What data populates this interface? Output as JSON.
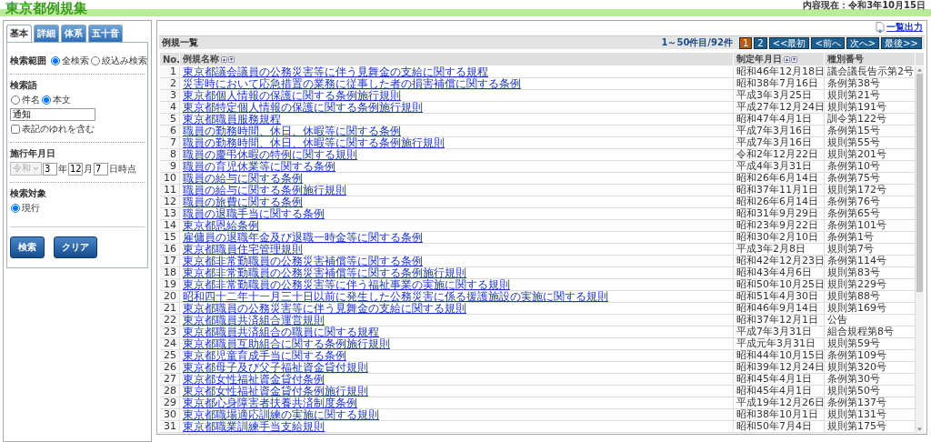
{
  "header": {
    "title": "東京都例規集",
    "as_of": "内容現在：令和3年10月15日"
  },
  "search_panel": {
    "tabs": [
      {
        "label": "基本",
        "selected": true
      },
      {
        "label": "詳細",
        "selected": false
      },
      {
        "label": "体系",
        "selected": false
      },
      {
        "label": "五十音",
        "selected": false
      }
    ],
    "scope": {
      "label": "検索範囲",
      "options": [
        {
          "label": "全検索",
          "selected": true
        },
        {
          "label": "絞込み検索",
          "selected": false
        }
      ]
    },
    "keyword": {
      "label": "検索語",
      "options": [
        {
          "label": "件名",
          "selected": false
        },
        {
          "label": "本文",
          "selected": true
        }
      ],
      "value": "通知",
      "variant_checkbox": {
        "label": "表記のゆれを含む",
        "checked": false
      }
    },
    "effective_date": {
      "label": "施行年月日",
      "era": "令和",
      "era_disabled": true,
      "year": "3",
      "year_unit": "年",
      "month": "12",
      "month_unit": "月",
      "day": "7",
      "day_unit": "日時点"
    },
    "target": {
      "label": "検索対象",
      "options": [
        {
          "label": "現行",
          "selected": true
        }
      ]
    },
    "buttons": [
      "検索",
      "クリア"
    ]
  },
  "results": {
    "export_link": "一覧出力",
    "title": "例規一覧",
    "range": "1～50件目/92件",
    "pages": [
      {
        "label": "1",
        "selected": true
      },
      {
        "label": "2",
        "selected": false
      }
    ],
    "nav": [
      "<<最初",
      "<前へ",
      "次へ>",
      "最後>>"
    ],
    "columns": [
      {
        "label": "No.",
        "sortable": false
      },
      {
        "label": "例規名称",
        "sortable": true
      },
      {
        "label": "制定年月日",
        "sortable": true
      },
      {
        "label": "種別番号",
        "sortable": false
      }
    ],
    "rows": [
      [
        "1",
        "東京都議会議員の公務災害等に伴う見舞金の支給に関する規程",
        "昭和46年12月18日",
        "議会議長告示第2号"
      ],
      [
        "2",
        "災害時において応急措置の業務に従事した者の損害補償に関する条例",
        "昭和38年7月16日",
        "条例第38号"
      ],
      [
        "3",
        "東京都個人情報の保護に関する条例施行規則",
        "平成3年3月25日",
        "規則第21号"
      ],
      [
        "4",
        "東京都特定個人情報の保護に関する条例施行規則",
        "平成27年12月24日",
        "規則第191号"
      ],
      [
        "5",
        "東京都職員服務規程",
        "昭和47年4月1日",
        "訓令第122号"
      ],
      [
        "6",
        "職員の勤務時間、休日、休暇等に関する条例",
        "平成7年3月16日",
        "条例第15号"
      ],
      [
        "7",
        "職員の勤務時間、休日、休暇等に関する条例施行規則",
        "平成7年3月16日",
        "規則第55号"
      ],
      [
        "8",
        "職員の慶弔休暇の特例に関する規則",
        "令和2年12月22日",
        "規則第201号"
      ],
      [
        "9",
        "職員の育児休業等に関する条例",
        "平成4年3月31日",
        "条例第10号"
      ],
      [
        "10",
        "職員の給与に関する条例",
        "昭和26年6月14日",
        "条例第75号"
      ],
      [
        "11",
        "職員の給与に関する条例施行規則",
        "昭和37年11月1日",
        "規則第172号"
      ],
      [
        "12",
        "職員の旅費に関する条例",
        "昭和26年6月14日",
        "条例第76号"
      ],
      [
        "13",
        "職員の退職手当に関する条例",
        "昭和31年9月29日",
        "条例第65号"
      ],
      [
        "14",
        "東京都恩給条例",
        "昭和23年9月22日",
        "条例第101号"
      ],
      [
        "15",
        "雇傭員の退職年金及び退職一時金等に関する条例",
        "昭和30年2月10日",
        "条例第1号"
      ],
      [
        "16",
        "東京都職員住宅管理規則",
        "平成3年2月8日",
        "規則第7号"
      ],
      [
        "17",
        "東京都非常勤職員の公務災害補償等に関する条例",
        "昭和42年12月23日",
        "条例第114号"
      ],
      [
        "18",
        "東京都非常勤職員の公務災害補償等に関する条例施行規則",
        "昭和43年4月6日",
        "規則第83号"
      ],
      [
        "19",
        "東京都非常勤職員の公務災害等に伴う福祉事業の実施に関する規則",
        "昭和50年10月25日",
        "規則第229号"
      ],
      [
        "20",
        "昭和四十二年十一月三十日以前に発生した公務災害に係る援護施設の実施に関する規則",
        "昭和51年4月30日",
        "規則第88号"
      ],
      [
        "21",
        "東京都職員の公務災害等に伴う見舞金の支給に関する規則",
        "昭和46年9月14日",
        "規則第169号"
      ],
      [
        "22",
        "東京都職員共済組合運営規則",
        "昭和37年12月1日",
        "公告"
      ],
      [
        "23",
        "東京都職員共済組合の職員に関する規程",
        "平成7年3月31日",
        "組合規程第8号"
      ],
      [
        "24",
        "東京都職員互助組合に関する条例施行規則",
        "平成元年3月31日",
        "規則第59号"
      ],
      [
        "25",
        "東京都児童育成手当に関する条例",
        "昭和44年10月15日",
        "条例第109号"
      ],
      [
        "26",
        "東京都母子及び父子福祉資金貸付規則",
        "昭和39年12月24日",
        "規則第320号"
      ],
      [
        "27",
        "東京都女性福祉資金貸付条例",
        "昭和45年4月1日",
        "条例第30号"
      ],
      [
        "28",
        "東京都女性福祉資金貸付条例施行規則",
        "昭和45年4月1日",
        "規則第50号"
      ],
      [
        "29",
        "東京都心身障害者扶養共済制度条例",
        "平成19年12月26日",
        "条例第137号"
      ],
      [
        "30",
        "東京都職場適応訓練の実施に関する規則",
        "昭和38年10月1日",
        "規則第131号"
      ],
      [
        "31",
        "東京都職業訓練手当支給規則",
        "昭和50年7月4日",
        "規則第175号"
      ]
    ]
  }
}
